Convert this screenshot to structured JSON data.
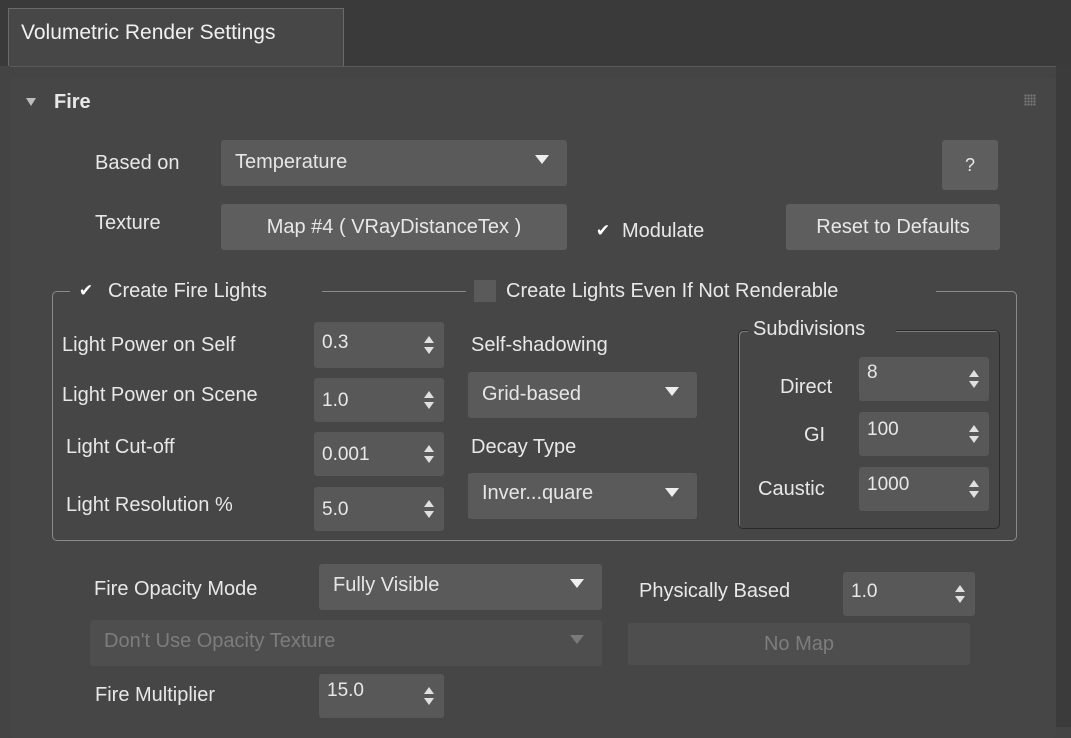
{
  "tab": {
    "title": "Volumetric Render Settings"
  },
  "rollout": {
    "title": "Fire"
  },
  "based_on": {
    "label": "Based on",
    "value": "Temperature"
  },
  "help_button": "?",
  "texture": {
    "label": "Texture",
    "map": "Map #4  ( VRayDistanceTex )",
    "modulate_label": "Modulate",
    "modulate_checked": true
  },
  "reset_button": "Reset to Defaults",
  "fire_lights": {
    "create_label": "Create Fire Lights",
    "create_checked": true,
    "not_renderable_label": "Create Lights Even If Not Renderable",
    "not_renderable_checked": false,
    "power_self": {
      "label": "Light Power on Self",
      "value": "0.3"
    },
    "power_scene": {
      "label": "Light Power on Scene",
      "value": "1.0"
    },
    "cutoff": {
      "label": "Light Cut-off",
      "value": "0.001"
    },
    "resolution": {
      "label": "Light Resolution %",
      "value": "5.0"
    },
    "self_shadowing": {
      "label": "Self-shadowing",
      "value": "Grid-based"
    },
    "decay": {
      "label": "Decay Type",
      "value": "Inver...quare"
    },
    "subdivisions": {
      "title": "Subdivisions",
      "direct": {
        "label": "Direct",
        "value": "8"
      },
      "gi": {
        "label": "GI",
        "value": "100"
      },
      "caustic": {
        "label": "Caustic",
        "value": "1000"
      }
    }
  },
  "opacity": {
    "mode_label": "Fire Opacity Mode",
    "mode_value": "Fully Visible",
    "physically_label": "Physically Based",
    "physically_value": "1.0",
    "texture_value": "Don't Use Opacity Texture",
    "no_map": "No Map"
  },
  "multiplier": {
    "label": "Fire Multiplier",
    "value": "15.0"
  }
}
